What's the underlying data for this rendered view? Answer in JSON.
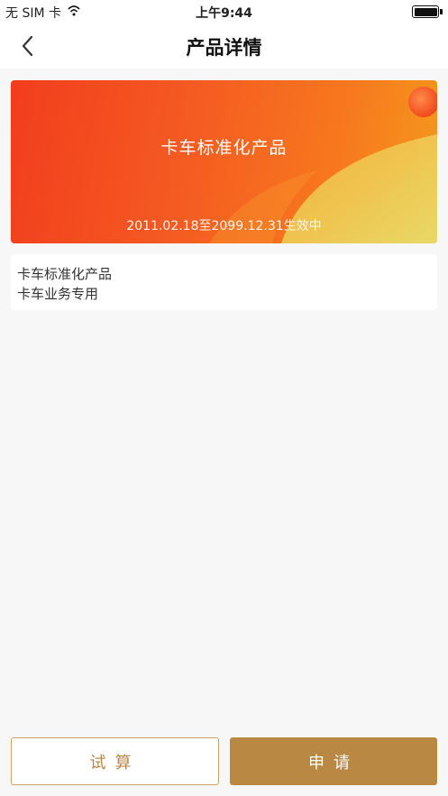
{
  "status_bar": {
    "carrier": "无 SIM 卡",
    "time": "上午9:44",
    "wifi_icon": "wifi-icon",
    "battery_level": 1.0
  },
  "nav": {
    "back_icon": "chevron-left-icon",
    "title": "产品详情"
  },
  "banner": {
    "title": "卡车标准化产品",
    "validity": "2011.02.18至2099.12.31生效中"
  },
  "description": {
    "lines": [
      "卡车标准化产品",
      "卡车业务专用"
    ]
  },
  "actions": {
    "trial_label": "试算",
    "apply_label": "申请"
  },
  "colors": {
    "banner_start": "#f23d1e",
    "banner_end": "#f39a1c",
    "accent_gold": "#b98843",
    "outline_gold": "#c9a36a",
    "background": "#f7f7f7"
  }
}
